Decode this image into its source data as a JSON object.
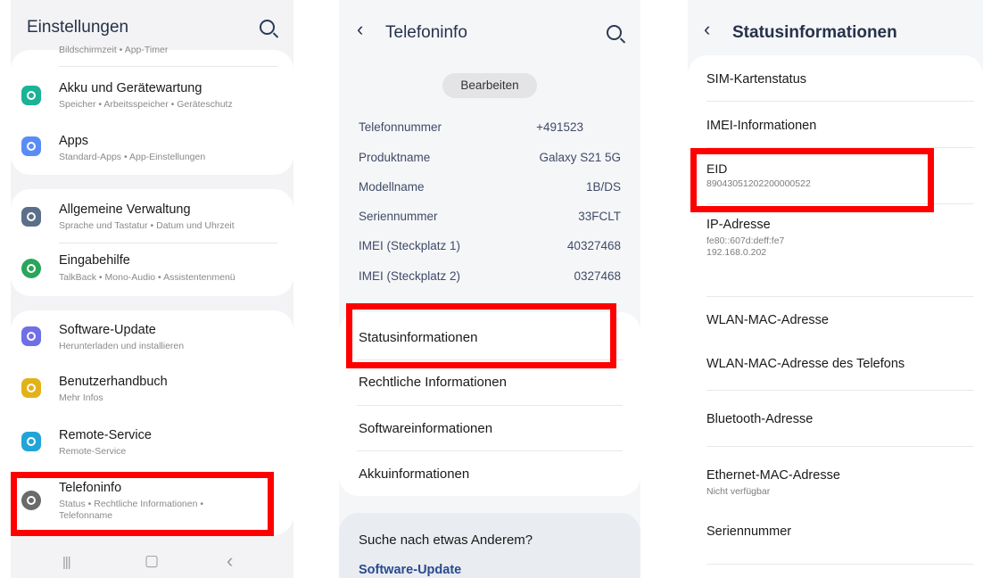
{
  "screen1": {
    "title": "Einstellungen",
    "top_sub": "Bildschirmzeit • App-Timer",
    "items": [
      {
        "title": "Akku und Gerätewartung",
        "subtitle": "Speicher • Arbeitsspeicher • Geräteschutz",
        "icon": "battery-care-icon",
        "color": "#1ab394"
      },
      {
        "title": "Apps",
        "subtitle": "Standard-Apps • App-Einstellungen",
        "icon": "apps-icon",
        "color": "#5a8cf6"
      },
      {
        "title": "Allgemeine Verwaltung",
        "subtitle": "Sprache und Tastatur • Datum und Uhrzeit",
        "icon": "general-management-icon",
        "color": "#5c6f8a"
      },
      {
        "title": "Eingabehilfe",
        "subtitle": "TalkBack • Mono-Audio • Assistentenmenü",
        "icon": "accessibility-icon",
        "color": "#2aa55a"
      },
      {
        "title": "Software-Update",
        "subtitle": "Herunterladen und installieren",
        "icon": "software-update-icon",
        "color": "#6f6fe6"
      },
      {
        "title": "Benutzerhandbuch",
        "subtitle": "Mehr Infos",
        "icon": "user-manual-icon",
        "color": "#e3b21a"
      },
      {
        "title": "Remote-Service",
        "subtitle": "Remote-Service",
        "icon": "remote-service-icon",
        "color": "#23a4d8"
      },
      {
        "title": "Telefoninfo",
        "subtitle": "Status • Rechtliche Informationen •",
        "subtitle2": "Telefonname",
        "icon": "phone-info-icon",
        "color": "#6a6a6a"
      }
    ],
    "nav": {
      "recent": "|||",
      "home": "▢",
      "back": "‹"
    }
  },
  "screen2": {
    "back": "‹",
    "title": "Telefoninfo",
    "edit_button": "Bearbeiten",
    "info": [
      {
        "label": "Telefonnummer",
        "value": "+491523"
      },
      {
        "label": "Produktname",
        "value": "Galaxy S21 5G"
      },
      {
        "label": "Modellname",
        "value": "1B/DS"
      },
      {
        "label": "Seriennummer",
        "value": "33FCLT"
      },
      {
        "label": "IMEI (Steckplatz 1)",
        "value": "40327468"
      },
      {
        "label": "IMEI (Steckplatz 2)",
        "value": "0327468"
      }
    ],
    "menu": [
      "Statusinformationen",
      "Rechtliche Informationen",
      "Softwareinformationen",
      "Akkuinformationen"
    ],
    "suggest_title": "Suche nach etwas Anderem?",
    "suggest_link": "Software-Update"
  },
  "screen3": {
    "back": "‹",
    "title": "Statusinformationen",
    "rows": [
      {
        "title": "SIM-Kartenstatus"
      },
      {
        "title": "IMEI-Informationen"
      },
      {
        "title": "EID",
        "value": "89043051202200000522"
      },
      {
        "title": "IP-Adresse",
        "value": "fe80::607d:deff:fe7",
        "value2": "192.168.0.202"
      },
      {
        "title": "WLAN-MAC-Adresse"
      },
      {
        "title": "WLAN-MAC-Adresse des Telefons"
      },
      {
        "title": "Bluetooth-Adresse"
      },
      {
        "title": "Ethernet-MAC-Adresse",
        "value": "Nicht verfügbar"
      },
      {
        "title": "Seriennummer"
      }
    ]
  },
  "highlight_color": "#ff0000"
}
